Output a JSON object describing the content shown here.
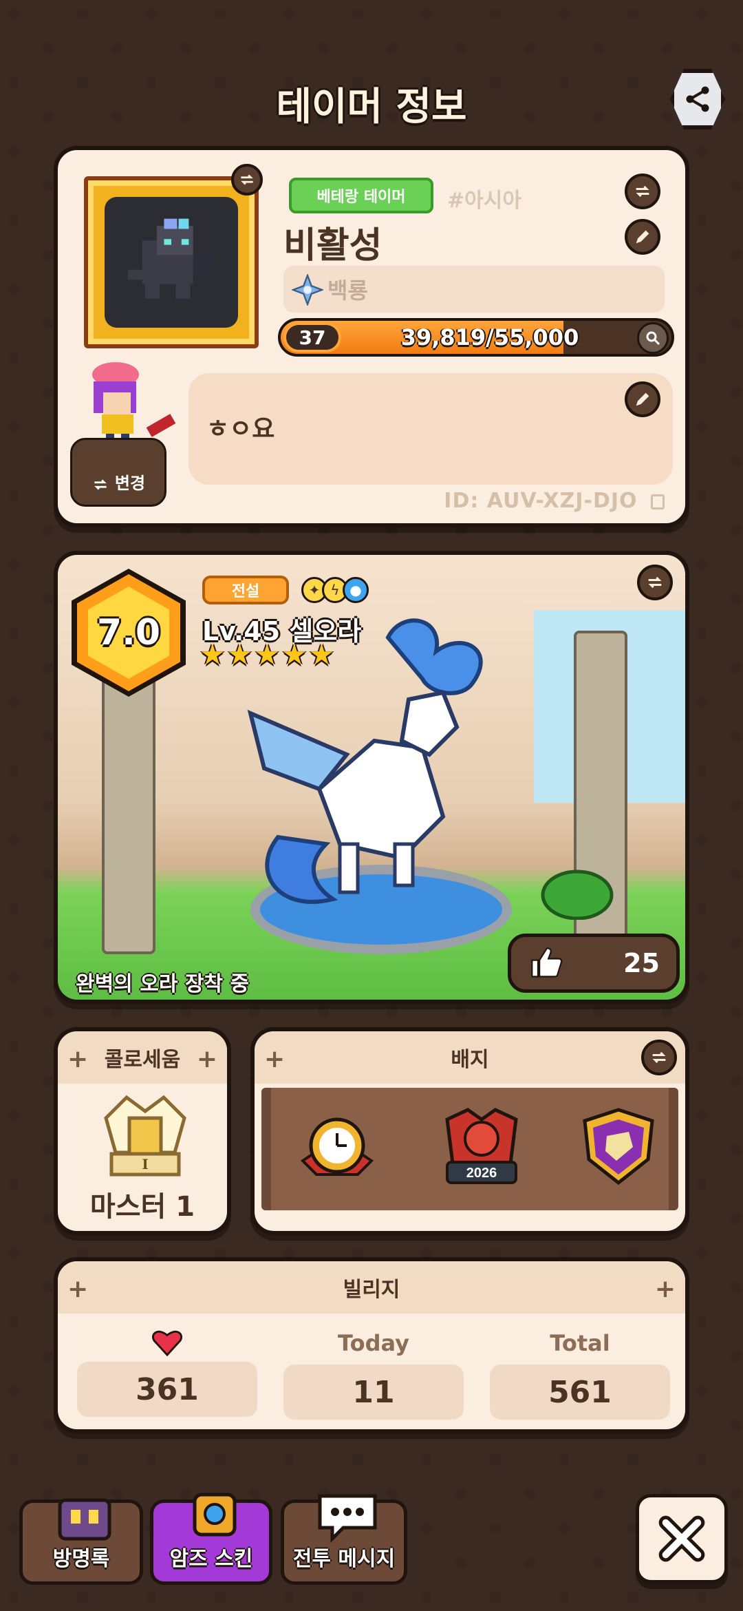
{
  "header": {
    "title": "테이머 정보"
  },
  "profile": {
    "tamer_badge": "베테랑 테이머",
    "region": "#아시아",
    "nickname": "비활성",
    "title_placeholder": "백룡",
    "level": "37",
    "exp_text": "39,819/55,000",
    "exp_current": 39819,
    "exp_max": 55000,
    "bio": "ㅎㅇ요",
    "change_label": "변경",
    "id_text": "ID: AUV-XZJ-DJO"
  },
  "pet": {
    "score": "7.0",
    "grade": "전설",
    "name": "Lv.45 셀오라",
    "stars": 5,
    "aura_status": "완벽의 오라 장착 중",
    "likes": "25"
  },
  "colosseum": {
    "title": "콜로세움",
    "rank": "마스터 1",
    "tier_label": "I"
  },
  "badges": {
    "title": "배지",
    "year_label": "2026"
  },
  "village": {
    "title": "빌리지",
    "today_label": "Today",
    "total_label": "Total",
    "hearts_value": "361",
    "today_value": "11",
    "total_value": "561"
  },
  "bottom_nav": {
    "guestbook": "방명록",
    "arms_skin": "암즈 스킨",
    "battle_message": "전투 메시지"
  },
  "colors": {
    "accent_orange": "#ffa332",
    "green_badge": "#6ad056",
    "background": "#3b2a22"
  }
}
